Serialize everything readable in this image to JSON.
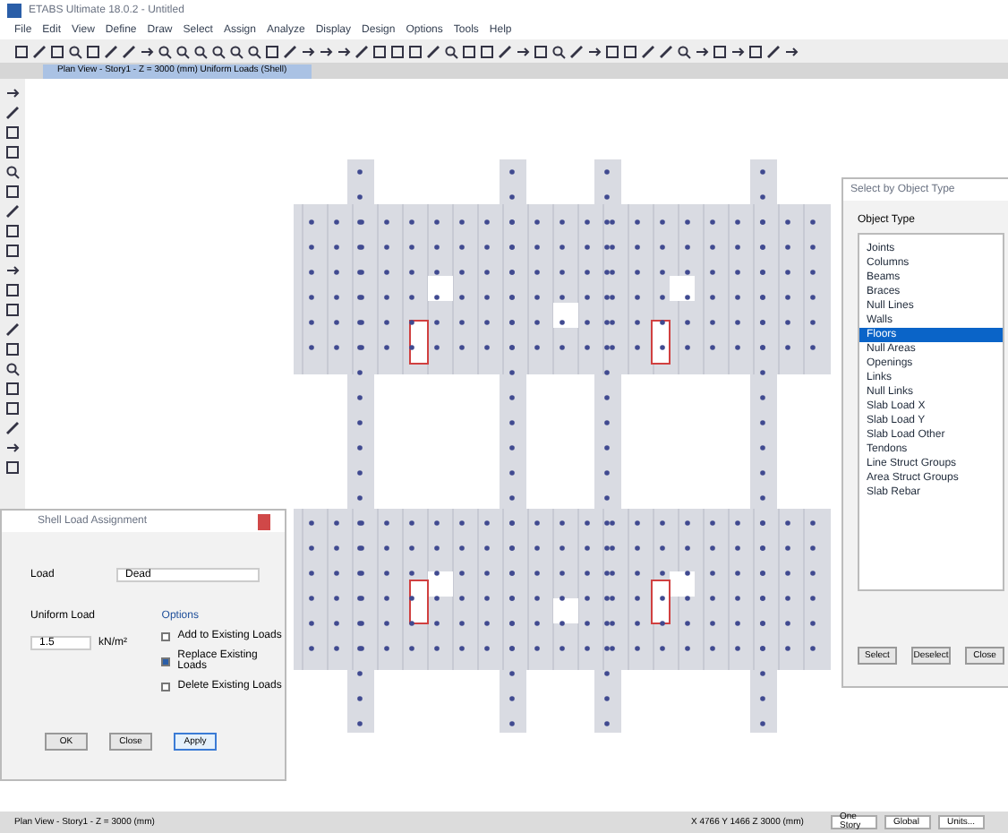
{
  "window": {
    "title": "ETABS Ultimate 18.0.2 - Untitled"
  },
  "menu": [
    "File",
    "Edit",
    "View",
    "Define",
    "Draw",
    "Select",
    "Assign",
    "Analyze",
    "Display",
    "Design",
    "Options",
    "Tools",
    "Help"
  ],
  "view_tab": {
    "title": "Plan View - Story1 - Z = 3000 (mm)  Uniform Loads (Shell)"
  },
  "left_dialog": {
    "title": "Shell Load Assignment",
    "load_label": "Load",
    "load_value": "Dead",
    "load_field_label": "Uniform Load",
    "load_field_value": "1.5",
    "units": "kN/m²",
    "options_title": "Options",
    "options": [
      {
        "label": "Add to Existing Loads",
        "selected": false
      },
      {
        "label": "Replace Existing Loads",
        "selected": true
      },
      {
        "label": "Delete Existing Loads",
        "selected": false
      }
    ],
    "buttons": [
      {
        "label": "OK",
        "selected": false
      },
      {
        "label": "Close",
        "selected": false
      },
      {
        "label": "Apply",
        "selected": true
      }
    ]
  },
  "right_dialog": {
    "title": "Select by Object Type",
    "group_title": "Object Type",
    "items": [
      {
        "label": "Joints",
        "selected": false
      },
      {
        "label": "Columns",
        "selected": false
      },
      {
        "label": "Beams",
        "selected": false
      },
      {
        "label": "Braces",
        "selected": false
      },
      {
        "label": "Null Lines",
        "selected": false
      },
      {
        "label": "Walls",
        "selected": false
      },
      {
        "label": "Floors",
        "selected": true
      },
      {
        "label": "Null Areas",
        "selected": false
      },
      {
        "label": "Openings",
        "selected": false
      },
      {
        "label": "Links",
        "selected": false
      },
      {
        "label": "Null Links",
        "selected": false
      },
      {
        "label": "Slab Load X",
        "selected": false
      },
      {
        "label": "Slab Load Y",
        "selected": false
      },
      {
        "label": "Slab Load Other",
        "selected": false
      },
      {
        "label": "Tendons",
        "selected": false
      },
      {
        "label": "Line Struct Groups",
        "selected": false
      },
      {
        "label": "Area Struct Groups",
        "selected": false
      },
      {
        "label": "Slab Rebar",
        "selected": false
      }
    ],
    "buttons": [
      "Select",
      "Deselect",
      "Close"
    ]
  },
  "status_bar": {
    "left": "Plan View - Story1 - Z = 3000 (mm)",
    "coords": "X 4766  Y 1466  Z 3000 (mm)",
    "dropdowns": [
      "One Story",
      "Global",
      "Units..."
    ]
  }
}
